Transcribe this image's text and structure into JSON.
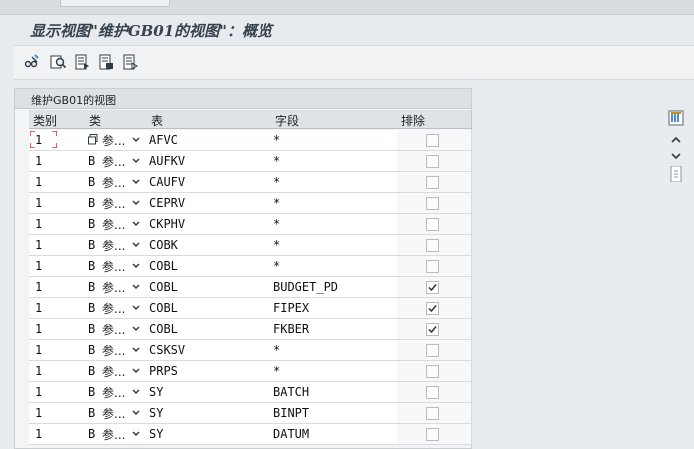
{
  "window": {
    "title": "显示视图\"维护GB01的视图\"：概览"
  },
  "toolbar": {
    "icons": [
      "edit-glasses-icon",
      "find-icon",
      "select-all-icon",
      "select-block-icon",
      "deselect-icon"
    ]
  },
  "panel": {
    "title": "维护GB01的视图"
  },
  "table": {
    "columns": {
      "cls": "类别",
      "typ": "类",
      "tab": "表",
      "fld": "字段",
      "exc": "排除"
    },
    "row_type_suffix": "参...",
    "rows": [
      {
        "cls": "1",
        "typ": "",
        "tab": "AFVC",
        "fld": "*",
        "exc": false
      },
      {
        "cls": "1",
        "typ": "B",
        "tab": "AUFKV",
        "fld": "*",
        "exc": false
      },
      {
        "cls": "1",
        "typ": "B",
        "tab": "CAUFV",
        "fld": "*",
        "exc": false
      },
      {
        "cls": "1",
        "typ": "B",
        "tab": "CEPRV",
        "fld": "*",
        "exc": false
      },
      {
        "cls": "1",
        "typ": "B",
        "tab": "CKPHV",
        "fld": "*",
        "exc": false
      },
      {
        "cls": "1",
        "typ": "B",
        "tab": "COBK",
        "fld": "*",
        "exc": false
      },
      {
        "cls": "1",
        "typ": "B",
        "tab": "COBL",
        "fld": "*",
        "exc": false
      },
      {
        "cls": "1",
        "typ": "B",
        "tab": "COBL",
        "fld": "BUDGET_PD",
        "exc": true
      },
      {
        "cls": "1",
        "typ": "B",
        "tab": "COBL",
        "fld": "FIPEX",
        "exc": true
      },
      {
        "cls": "1",
        "typ": "B",
        "tab": "COBL",
        "fld": "FKBER",
        "exc": true
      },
      {
        "cls": "1",
        "typ": "B",
        "tab": "CSKSV",
        "fld": "*",
        "exc": false
      },
      {
        "cls": "1",
        "typ": "B",
        "tab": "PRPS",
        "fld": "*",
        "exc": false
      },
      {
        "cls": "1",
        "typ": "B",
        "tab": "SY",
        "fld": "BATCH",
        "exc": false
      },
      {
        "cls": "1",
        "typ": "B",
        "tab": "SY",
        "fld": "BINPT",
        "exc": false
      },
      {
        "cls": "1",
        "typ": "B",
        "tab": "SY",
        "fld": "DATUM",
        "exc": false
      }
    ]
  },
  "scroll": {
    "icons": [
      "column-settings-icon",
      "scroll-up-icon",
      "scroll-down-icon",
      "scroll-thumb-icon"
    ]
  }
}
